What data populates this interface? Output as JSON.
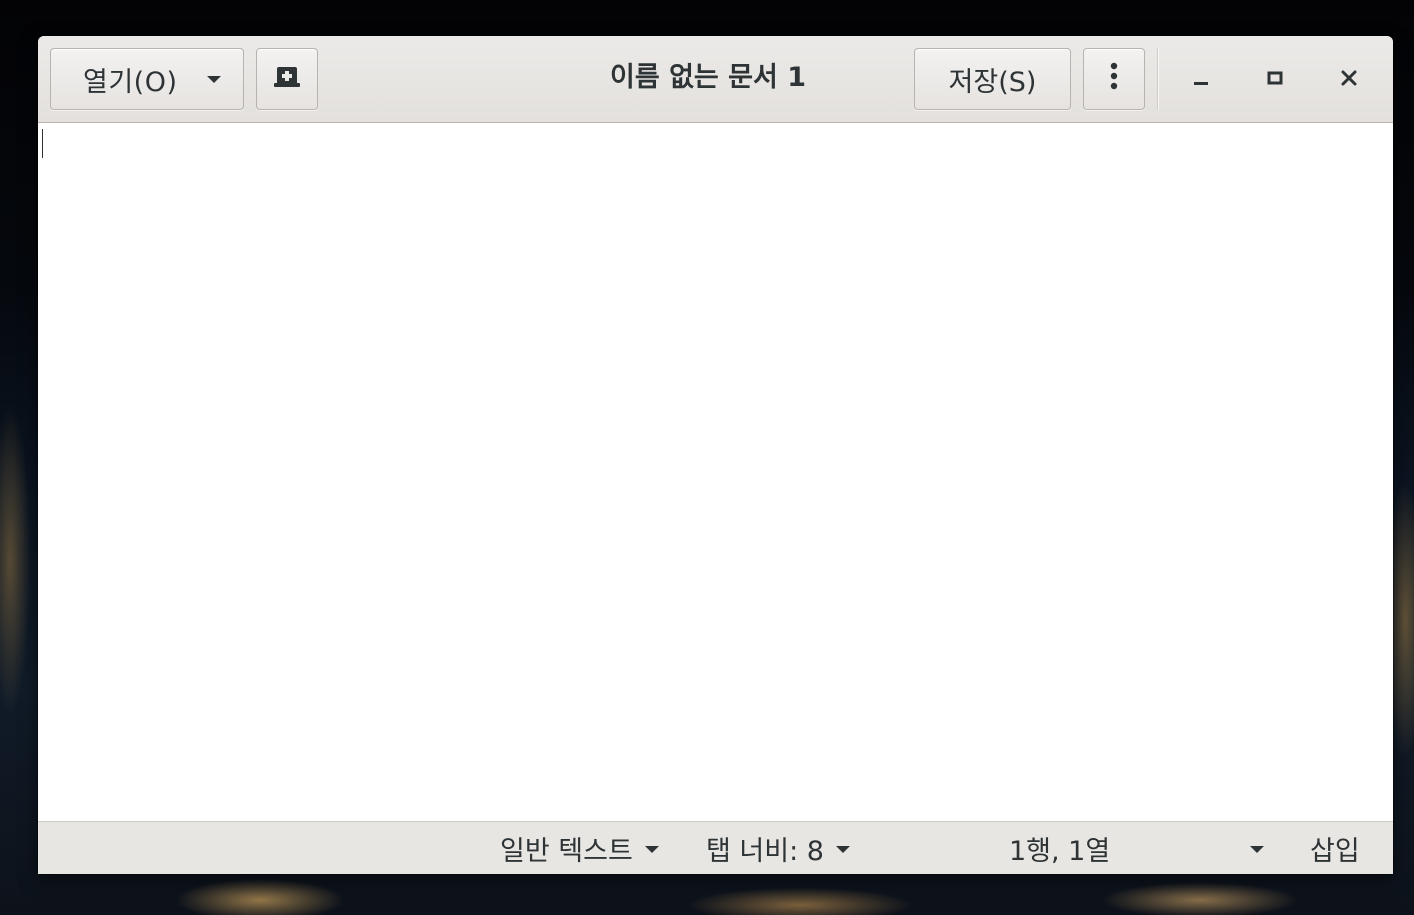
{
  "header": {
    "open_label": "열기(O)",
    "title": "이름 없는 문서 1",
    "save_label": "저장(S)"
  },
  "icons": {
    "open_dropdown": "chevron-down-icon",
    "new_document": "new-tab-icon",
    "menu": "vertical-dots-icon",
    "minimize": "minimize-icon",
    "maximize": "maximize-icon",
    "close": "close-icon"
  },
  "editor": {
    "content": ""
  },
  "statusbar": {
    "language": "일반 텍스트",
    "tab_width": "탭 너비: 8",
    "position": "1행, 1열",
    "mode": "삽입"
  }
}
